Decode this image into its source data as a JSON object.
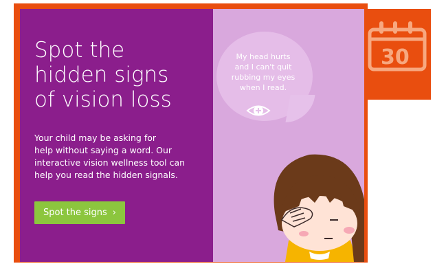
{
  "promo": {
    "headline": "Spot the\nhidden signs\nof vision loss",
    "body": "Your child may be asking for\nhelp without saying a word. Our\ninteractive vision wellness tool can\nhelp you read the hidden signals.",
    "cta_label": "Spot the signs",
    "cta_chevron": "›"
  },
  "speech_bubble": {
    "text": "My head hurts\nand I can't quit\nrubbing my eyes\nwhen I read."
  },
  "calendar_badge": {
    "number": "30"
  },
  "colors": {
    "frame": "#e94e0f",
    "left_panel": "#8b1e8c",
    "right_panel": "#d9a8dd",
    "cta": "#8cc63e"
  },
  "icons": [
    "calendar-icon",
    "eye-plus-icon"
  ]
}
